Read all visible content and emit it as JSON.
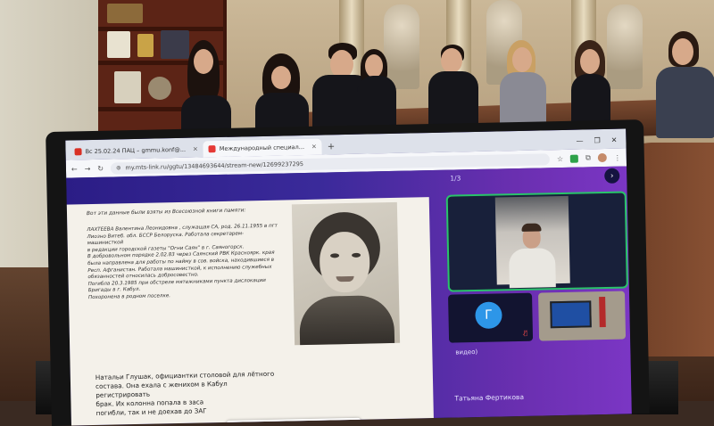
{
  "browser": {
    "tabs": [
      {
        "label": "Вс 25.02.24 ПАЦ – gmmu.konf@...",
        "active": false,
        "favicon_color": "#d93025"
      },
      {
        "label": "Международный специал...",
        "active": true,
        "favicon_color": "#e53935"
      }
    ],
    "url": "my.mts-link.ru/ggtu/13484693644/stream-new/12699237295"
  },
  "webinar": {
    "slide_counter": "1/3",
    "participant_initial": "Г",
    "participant_label_partial": "видео)",
    "participant_name": "Татьяна Фертикова"
  },
  "slide": {
    "intro": "Вот эти данные были взяты из Всесоюзной книги памяти:",
    "bio_lines": [
      "ЛАХТЕЕВА Валентина Леонидовна , служащая СА, род. 26.11.1955 в пгт",
      "Лиозно Витеб. обл. БССР Белоруска. Работала секретарем-машинисткой",
      "в редакции городской газеты \"Огни Саян\" в г. Саяногорск.",
      "В добровольном порядке 2.02.83 через Саянский РВК Красноярк. края",
      "была направлена для работы по найму в сов. войска, находившиеся в",
      "Респ. Афганистан. Работала машинисткой, к исполнению служебных",
      "обязанностей относилась добросовестно.",
      "Погибла 20.3.1985 при обстреле мятежниками пункта дислокации",
      "Бригады в г. Кабул.",
      "Похоронена в родном поселке."
    ],
    "lower_lines": [
      "Натальи Глушак, официантки столовой для лётного",
      "состава. Она ехала с женихом в Кабул регистрировать",
      "брак. Их колонна попала в заса",
      "погибли, так и не доехав до ЗАГ"
    ]
  }
}
